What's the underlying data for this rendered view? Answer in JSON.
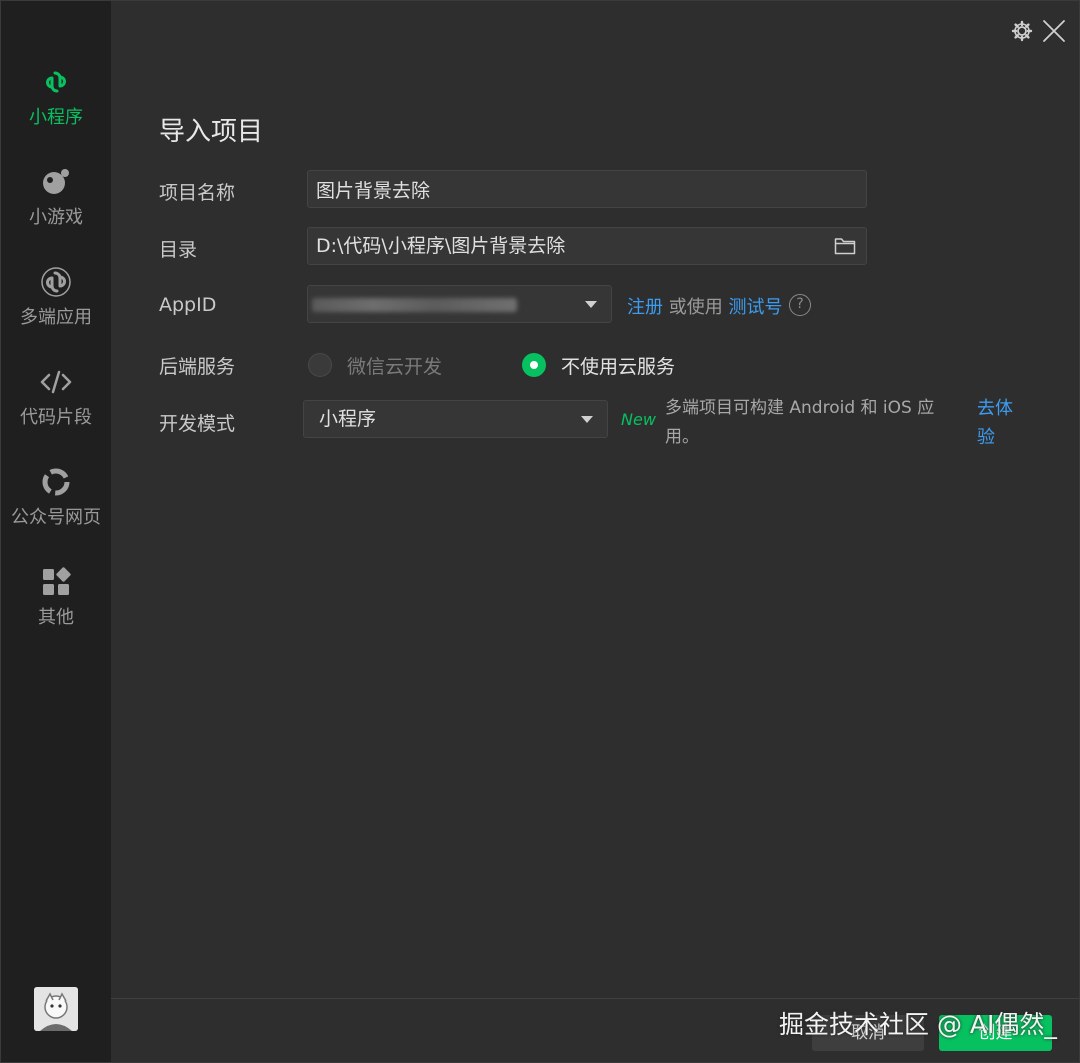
{
  "sidebar": {
    "items": [
      {
        "label": "小程序",
        "icon": "mini-program-icon",
        "active": true
      },
      {
        "label": "小游戏",
        "icon": "mini-game-icon"
      },
      {
        "label": "多端应用",
        "icon": "multi-platform-icon"
      },
      {
        "label": "代码片段",
        "icon": "code-snippet-icon"
      },
      {
        "label": "公众号网页",
        "icon": "official-account-icon"
      },
      {
        "label": "其他",
        "icon": "grid-icon"
      }
    ]
  },
  "form": {
    "title": "导入项目",
    "project_name": {
      "label": "项目名称",
      "value": "图片背景去除"
    },
    "directory": {
      "label": "目录",
      "value": "D:\\代码\\小程序\\图片背景去除"
    },
    "appid": {
      "label": "AppID",
      "register_link": "注册",
      "or_use": "或使用",
      "test_link": "测试号",
      "help": "?"
    },
    "backend": {
      "label": "后端服务",
      "option_cloud": "微信云开发",
      "option_none": "不使用云服务",
      "selected": "option_none"
    },
    "dev_mode": {
      "label": "开发模式",
      "value": "小程序",
      "badge": "New",
      "desc_line1": "多端项目可构建 Android 和 iOS 应",
      "desc_line2": "用。",
      "try_link_1": "去体",
      "try_link_2": "验"
    }
  },
  "footer": {
    "cancel_label": "取消",
    "create_label": "创建"
  },
  "watermark": "掘金技术社区 @ AI偶然_",
  "colors": {
    "accent": "#07c160",
    "link": "#3d9cf0",
    "background": "#2e2e2e",
    "sidebar": "#1f1f1f"
  }
}
